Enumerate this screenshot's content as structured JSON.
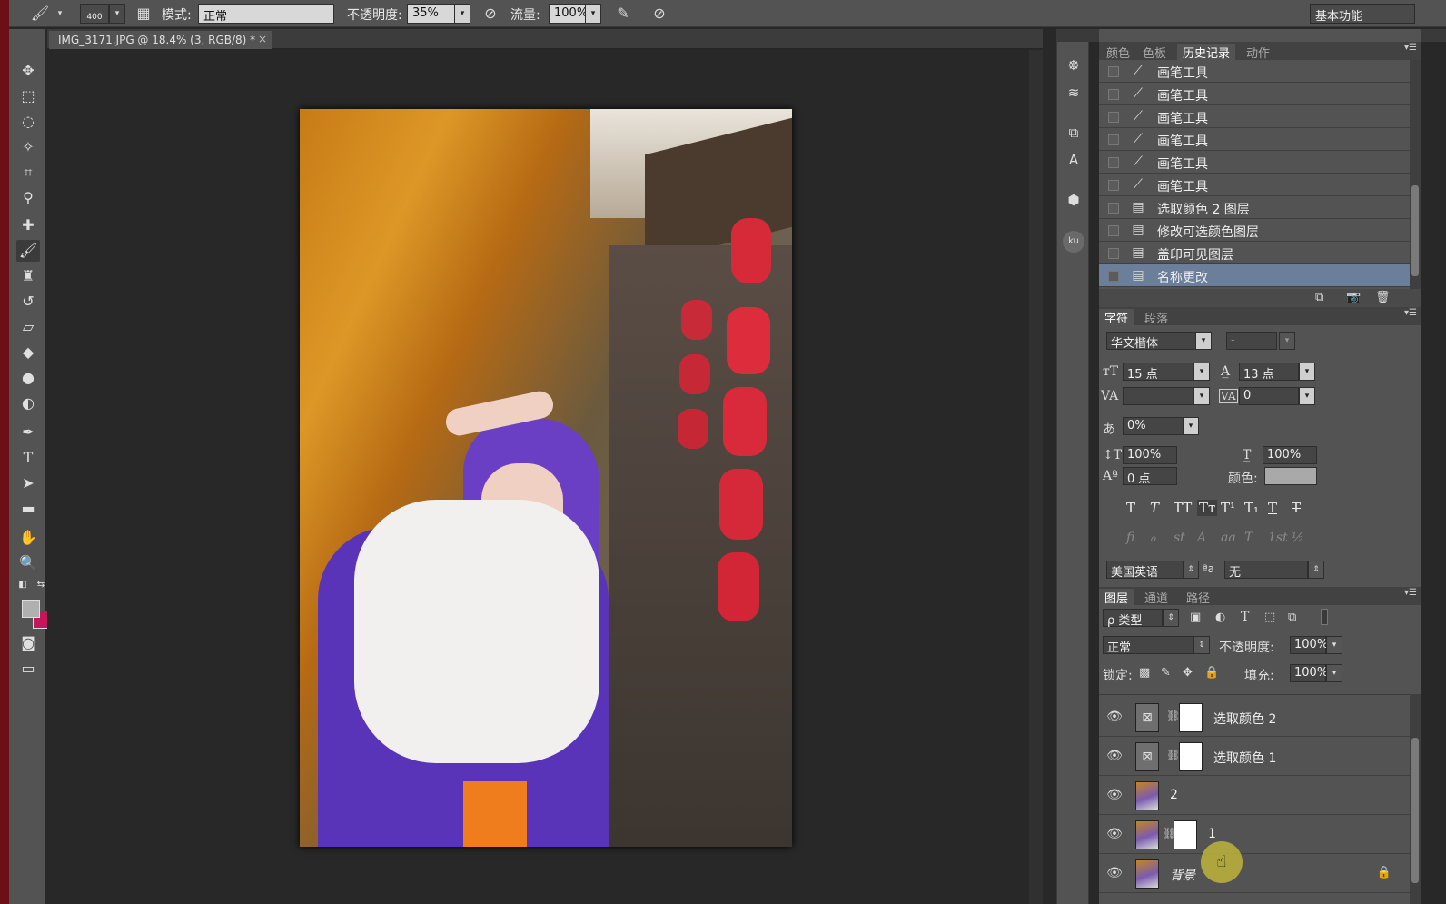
{
  "options_bar": {
    "brush_size": "400",
    "mode_label": "模式:",
    "mode_value": "正常",
    "opacity_label": "不透明度:",
    "opacity_value": "35%",
    "flow_label": "流量:",
    "flow_value": "100%",
    "workspace": "基本功能"
  },
  "document": {
    "tab_title": "IMG_3171.JPG @ 18.4% (3, RGB/8) *",
    "close": "×"
  },
  "panel_tabs_top": [
    "颜色",
    "色板",
    "历史记录",
    "动作"
  ],
  "history": [
    {
      "label": "画笔工具",
      "icon": "brush-icon",
      "selected": false
    },
    {
      "label": "画笔工具",
      "icon": "brush-icon",
      "selected": false
    },
    {
      "label": "画笔工具",
      "icon": "brush-icon",
      "selected": false
    },
    {
      "label": "画笔工具",
      "icon": "brush-icon",
      "selected": false
    },
    {
      "label": "画笔工具",
      "icon": "brush-icon",
      "selected": false
    },
    {
      "label": "画笔工具",
      "icon": "brush-icon",
      "selected": false
    },
    {
      "label": "选取颜色 2 图层",
      "icon": "document-icon",
      "selected": false
    },
    {
      "label": "修改可选颜色图层",
      "icon": "document-icon",
      "selected": false
    },
    {
      "label": "盖印可见图层",
      "icon": "document-icon",
      "selected": false
    },
    {
      "label": "名称更改",
      "icon": "document-icon",
      "selected": true
    }
  ],
  "char_tabs": [
    "字符",
    "段落"
  ],
  "character": {
    "font_family": "华文楷体",
    "font_style": "-",
    "font_size": "15 点",
    "leading": "13 点",
    "kerning": "",
    "tracking": "0",
    "tsume": "0%",
    "vscale": "100%",
    "hscale": "100%",
    "baseline": "0 点",
    "color_label": "颜色:",
    "color_swatch": "#a9a9a9",
    "language": "美国英语",
    "aa_label": "ªa",
    "antialias": "无",
    "type_buttons": [
      "T",
      "T",
      "TT",
      "Tт",
      "T¹",
      "T₁",
      "T",
      "T"
    ],
    "ot_buttons": [
      "fi",
      "ℴ",
      "st",
      "A",
      "aa",
      "T",
      "1st",
      "½"
    ]
  },
  "layer_tabs": [
    "图层",
    "通道",
    "路径"
  ],
  "layers_panel": {
    "filter_kind": "ρ 类型",
    "blend_mode": "正常",
    "opacity_label": "不透明度:",
    "opacity_value": "100%",
    "lock_label": "锁定:",
    "fill_label": "填充:",
    "fill_value": "100%"
  },
  "layers": [
    {
      "name": "选取颜色 2",
      "kind": "adjustment",
      "italic": false,
      "locked": false
    },
    {
      "name": "选取颜色 1",
      "kind": "adjustment",
      "italic": false,
      "locked": false
    },
    {
      "name": "2",
      "kind": "image",
      "italic": false,
      "locked": false
    },
    {
      "name": "1",
      "kind": "image-mask",
      "italic": false,
      "locked": false
    },
    {
      "name": "背景",
      "kind": "image",
      "italic": true,
      "locked": true
    }
  ],
  "colors": {
    "foreground": "#b0b0b0",
    "background": "#c2185b",
    "selection": "#6b7f9a"
  }
}
